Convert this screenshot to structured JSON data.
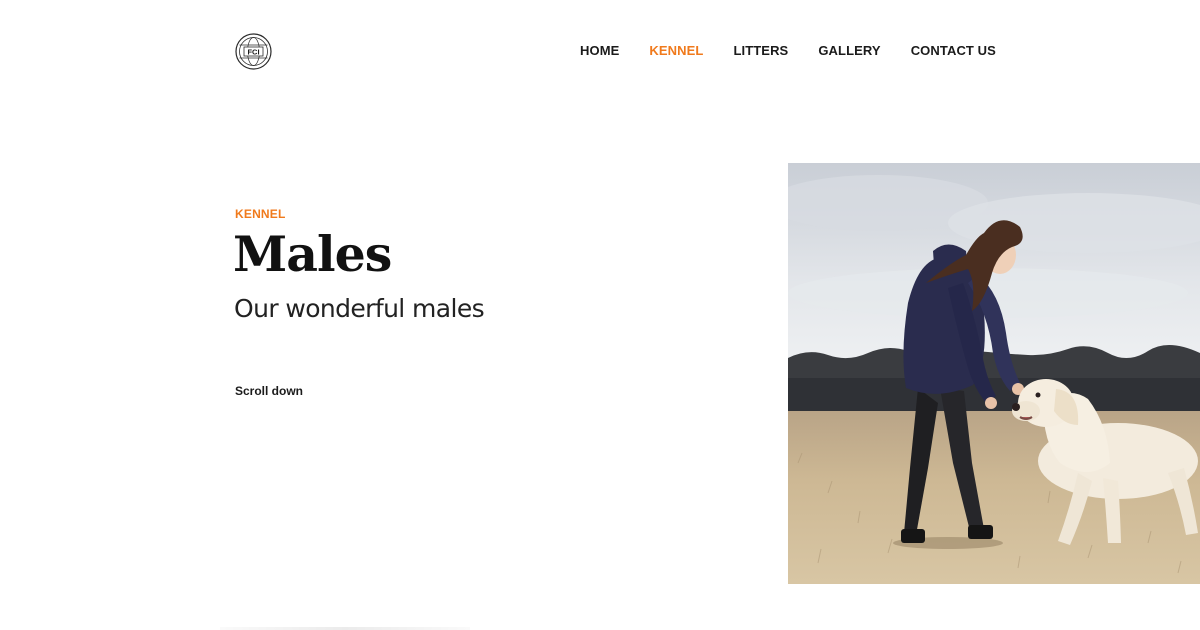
{
  "header": {
    "logo": {
      "icon": "fci-globe-logo",
      "text": "FCI"
    },
    "nav": [
      {
        "label": "HOME",
        "active": false
      },
      {
        "label": "KENNEL",
        "active": true
      },
      {
        "label": "LITTERS",
        "active": false
      },
      {
        "label": "GALLERY",
        "active": false
      },
      {
        "label": "CONTACT US",
        "active": false
      }
    ]
  },
  "hero": {
    "eyebrow": "KENNEL",
    "title": "Males",
    "subtitle": "Our wonderful males",
    "scroll_label": "Scroll down",
    "image_subject": "girl-with-white-dog-photo"
  },
  "colors": {
    "accent": "#f07a1c",
    "text": "#111111",
    "background": "#ffffff"
  }
}
